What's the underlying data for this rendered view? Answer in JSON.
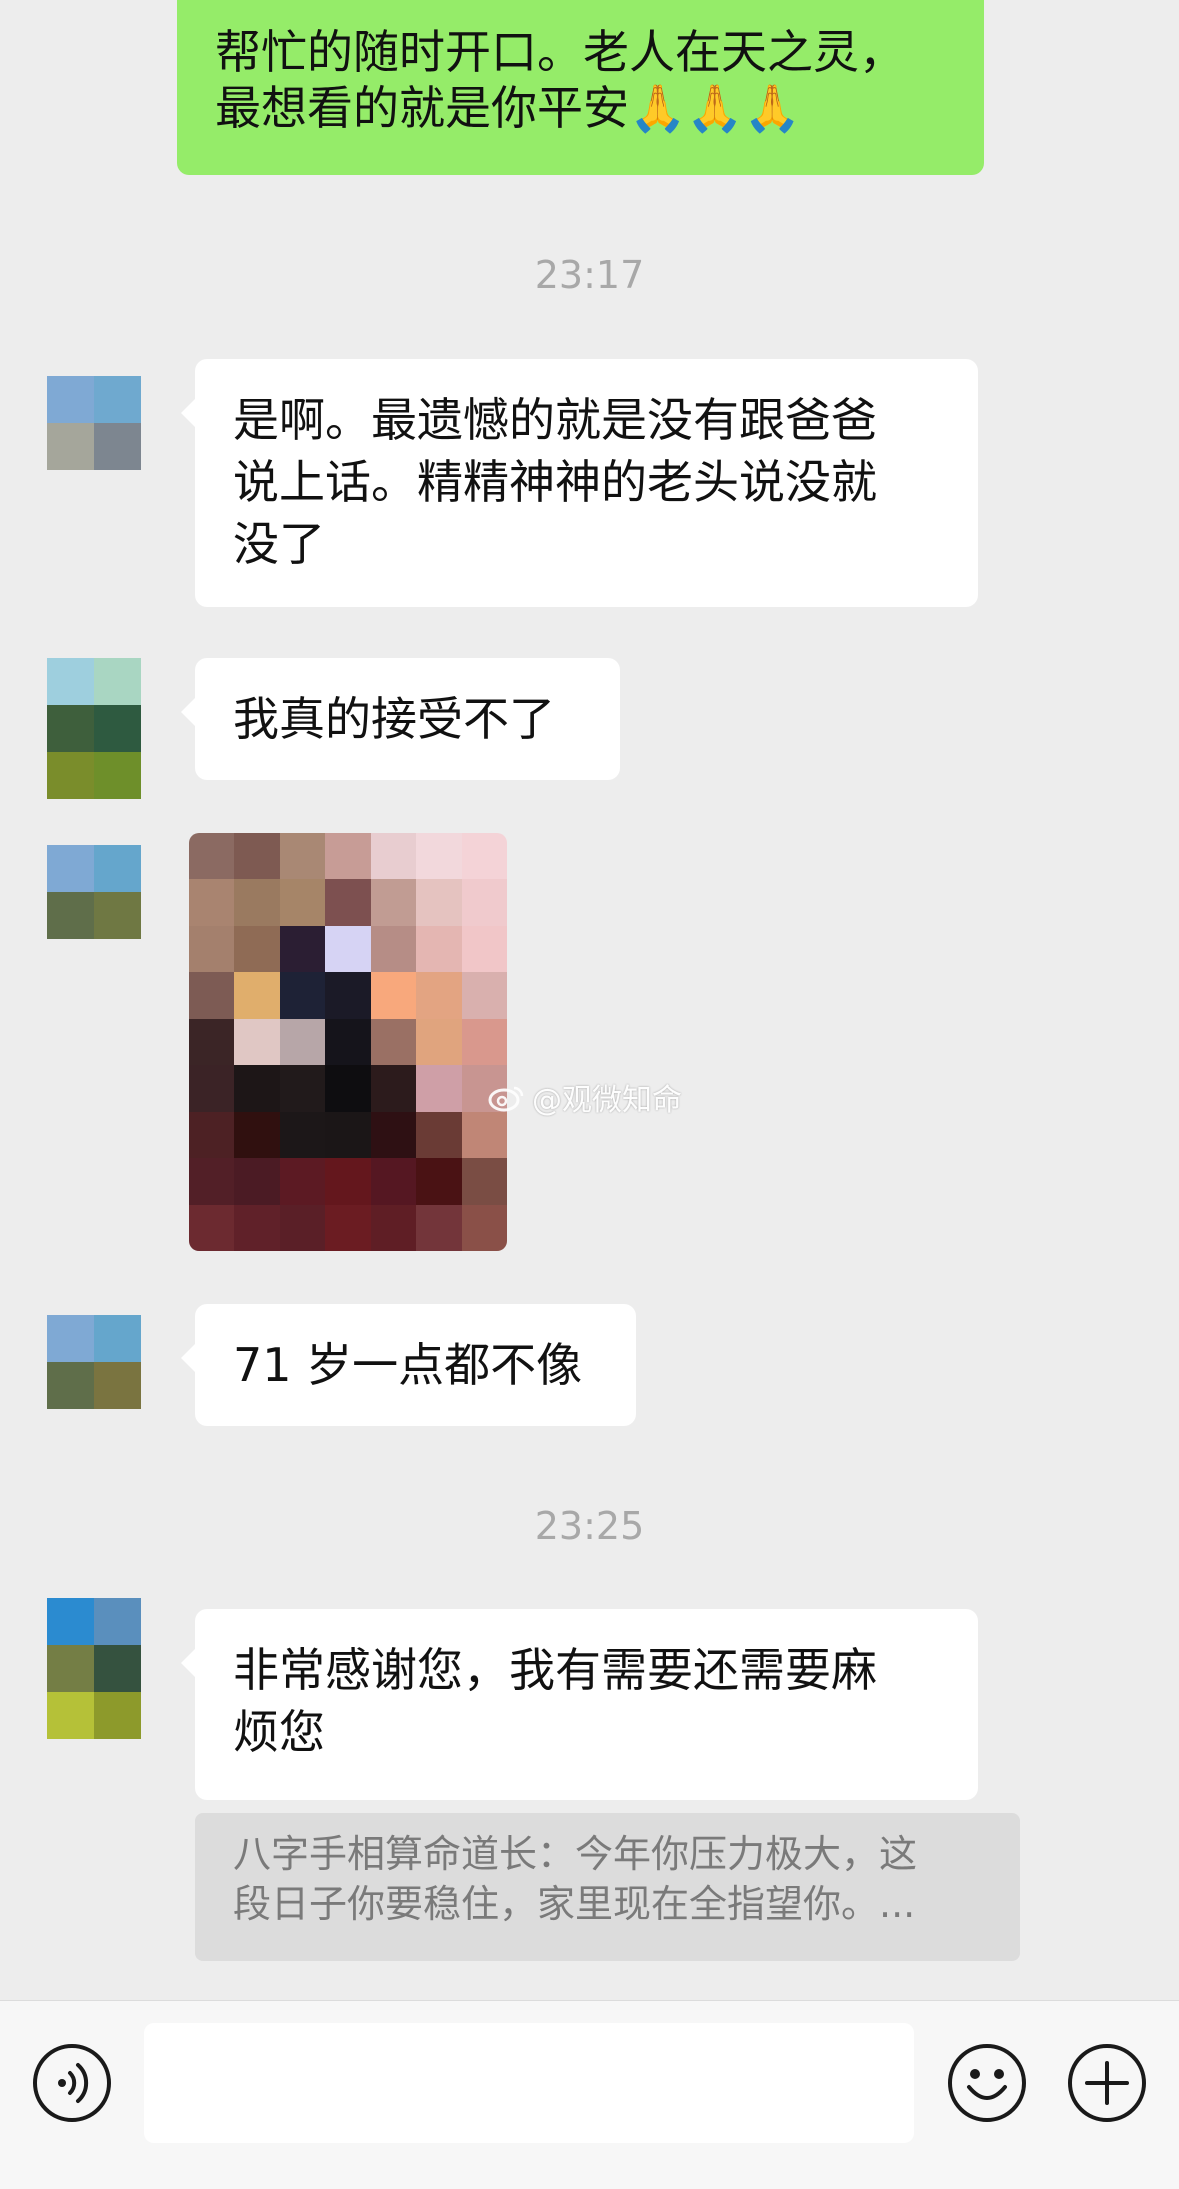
{
  "messages": {
    "sent_partial": {
      "line1": "帮忙的随时开口。老人在天之灵，",
      "line2": "最想看的就是你平安🙏🙏🙏"
    },
    "time1": "23:17",
    "msg1": {
      "line1": "是啊。最遗憾的就是没有跟爸爸",
      "line2": "说上话。精精神神的老头说没就",
      "line3": "没了"
    },
    "msg2": "我真的接受不了",
    "image_watermark": "@观微知命",
    "msg3": "71 岁一点都不像",
    "time2": "23:25",
    "msg4": {
      "line1": "非常感谢您，我有需要还需要麻",
      "line2": "烦您"
    },
    "quote": {
      "line1": "八字手相算命道长：今年你压力极大，这",
      "line2": "段日子你要稳住，家里现在全指望你。..."
    }
  },
  "input": {
    "value": ""
  },
  "colors": {
    "sent_bubble": "#95ec69",
    "received_bubble": "#ffffff",
    "background": "#ededed",
    "quote_bg": "#dcdcdc"
  },
  "icons": {
    "voice": "voice-icon",
    "emoji": "emoji-icon",
    "plus": "plus-icon"
  }
}
